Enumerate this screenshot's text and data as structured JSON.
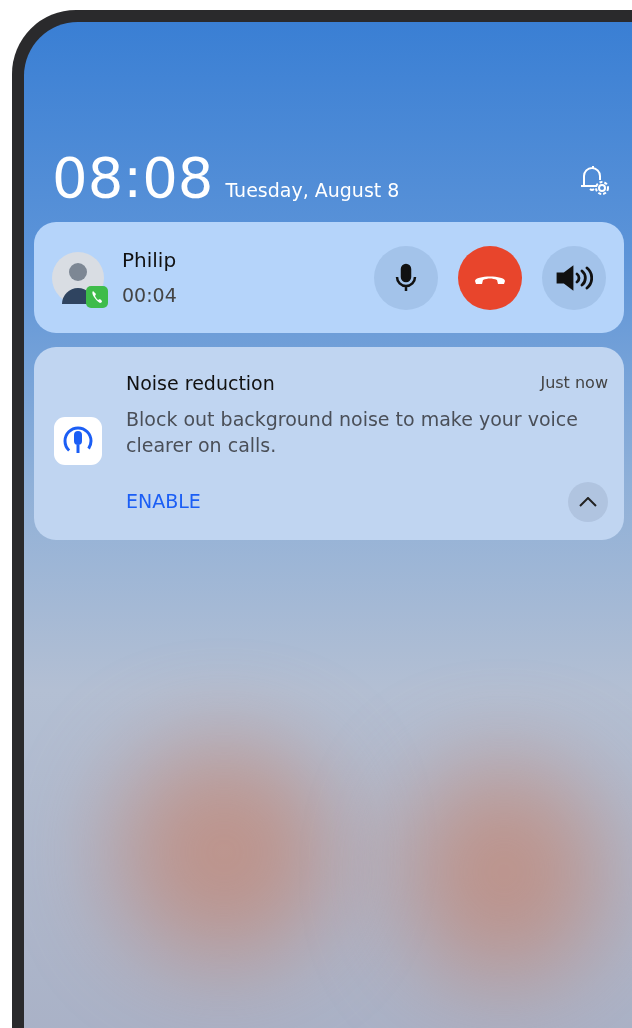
{
  "lock_screen": {
    "time": "08:08",
    "date": "Tuesday, August 8"
  },
  "call": {
    "name": "Philip",
    "duration": "00:04",
    "muted": false,
    "speaker_on": false
  },
  "notification": {
    "title": "Noise reduction",
    "time": "Just now",
    "body": "Block out background noise to make your voice clearer on calls.",
    "action": "ENABLE",
    "expanded": true
  }
}
